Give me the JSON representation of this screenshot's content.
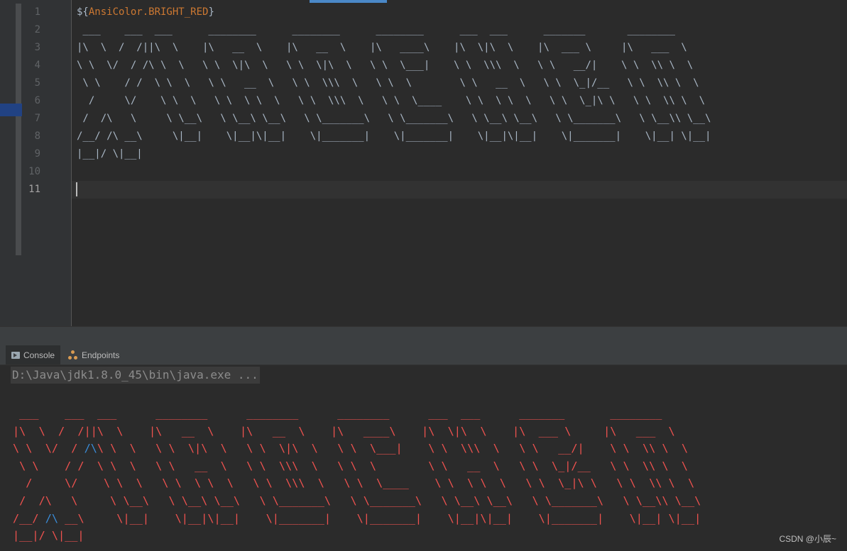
{
  "editor": {
    "line_numbers": [
      "1",
      "2",
      "3",
      "4",
      "5",
      "6",
      "7",
      "8",
      "9",
      "10",
      "11"
    ],
    "line1_prefix": "${",
    "line1_key": "AnsiColor.BRIGHT_RED",
    "line1_suffix": "}",
    "ascii_art": " ___    ___  ___      ________      ________      ________      ___  ___      _______       ________     \n|\\  \\  /  /||\\  \\    |\\   __  \\    |\\   __  \\    |\\   ____\\    |\\  \\|\\  \\    |\\  ___ \\     |\\   ___  \\    \n\\ \\  \\/  / /\\ \\  \\   \\ \\  \\|\\  \\   \\ \\  \\|\\  \\   \\ \\  \\___|    \\ \\  \\\\\\  \\   \\ \\   __/|    \\ \\  \\\\ \\  \\   \n \\ \\    / /  \\ \\  \\   \\ \\   __  \\   \\ \\  \\\\\\  \\   \\ \\  \\        \\ \\   __  \\   \\ \\  \\_|/__   \\ \\  \\\\ \\  \\  \n  /     \\/    \\ \\  \\   \\ \\  \\ \\  \\   \\ \\  \\\\\\  \\   \\ \\  \\____    \\ \\  \\ \\  \\   \\ \\  \\_|\\ \\   \\ \\  \\\\ \\  \\ \n /  /\\   \\     \\ \\__\\   \\ \\__\\ \\__\\   \\ \\_______\\   \\ \\_______\\   \\ \\__\\ \\__\\   \\ \\_______\\   \\ \\__\\\\ \\__\\\n/__/ /\\ __\\     \\|__|    \\|__|\\|__|    \\|_______|    \\|_______|    \\|__|\\|__|    \\|_______|    \\|__| \\|__|\n|__|/ \\|__|                                                                                                 ",
    "active_line": "11"
  },
  "tool_window": {
    "tabs": [
      {
        "label": "Console",
        "icon": "console-icon"
      },
      {
        "label": "Endpoints",
        "icon": "endpoints-icon"
      }
    ]
  },
  "console": {
    "command": "D:\\Java\\jdk1.8.0_45\\bin\\java.exe ...",
    "banner_color": "#f0524f",
    "banner_lines": [
      " ___    ___  ___      ________      ________      ________      ___  ___      _______       ________",
      "|\\  \\  /  /||\\  \\    |\\   __  \\    |\\   __  \\    |\\   ____\\    |\\  \\|\\  \\    |\\  ___ \\     |\\   ___  \\",
      "\\ \\  \\/  / ",
      "\\ \\  \\   \\ \\  \\|\\  \\   \\ \\  \\|\\  \\   \\ \\  \\___|    \\ \\  \\\\\\  \\   \\ \\   __/|    \\ \\  \\\\ \\  \\",
      " \\ \\    / /  \\ \\  \\   \\ \\   __  \\   \\ \\  \\\\\\  \\   \\ \\  \\        \\ \\   __  \\   \\ \\  \\_|/__   \\ \\  \\\\ \\  \\",
      "  /     \\/    \\ \\  \\   \\ \\  \\ \\  \\   \\ \\  \\\\\\  \\   \\ \\  \\____    \\ \\  \\ \\  \\   \\ \\  \\_|\\ \\   \\ \\  \\\\ \\  \\",
      " /  /\\   \\     \\ \\__\\   \\ \\__\\ \\__\\   \\ \\_______\\   \\ \\_______\\   \\ \\__\\ \\__\\   \\ \\_______\\   \\ \\__\\\\ \\__\\",
      "/__/ ",
      " __\\     \\|__|    \\|__|\\|__|    \\|_______|    \\|_______|    \\|__|\\|__|    \\|_______|    \\|__| \\|__|",
      "|__|/ \\|__|"
    ],
    "glyph": "/\\"
  },
  "watermark": "CSDN @小辰~"
}
